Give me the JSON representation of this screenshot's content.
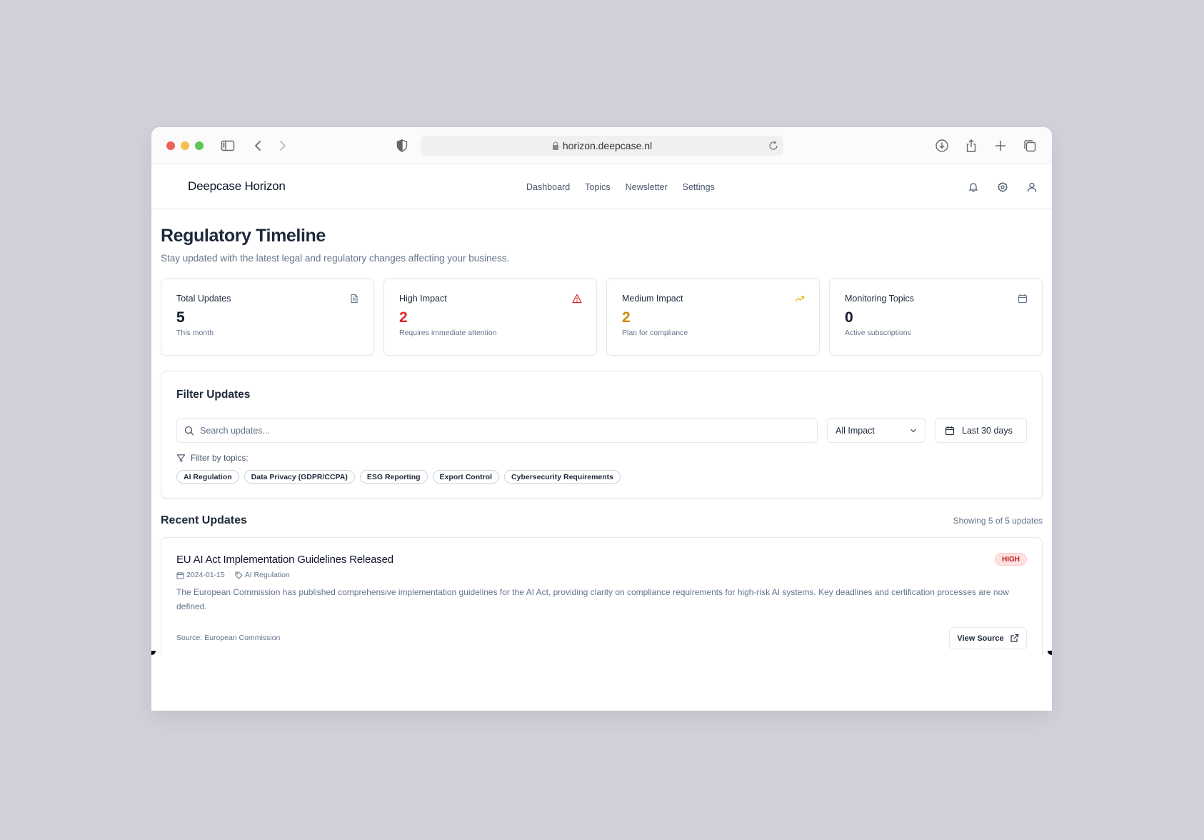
{
  "browser": {
    "url": "horizon.deepcase.nl"
  },
  "app": {
    "brand": "Deepcase Horizon",
    "nav": [
      "Dashboard",
      "Topics",
      "Newsletter",
      "Settings"
    ]
  },
  "page": {
    "title": "Regulatory Timeline",
    "subtitle": "Stay updated with the latest legal and regulatory changes affecting your business."
  },
  "stats": [
    {
      "label": "Total Updates",
      "value": "5",
      "note": "This month",
      "icon": "document-icon",
      "color": "#0f172a"
    },
    {
      "label": "High Impact",
      "value": "2",
      "note": "Requires immediate attention",
      "icon": "alert-triangle-icon",
      "color": "#dc2626"
    },
    {
      "label": "Medium Impact",
      "value": "2",
      "note": "Plan for compliance",
      "icon": "trending-up-icon",
      "color": "#ca8a04"
    },
    {
      "label": "Monitoring Topics",
      "value": "0",
      "note": "Active subscriptions",
      "icon": "calendar-icon",
      "color": "#0f172a"
    }
  ],
  "filter": {
    "title": "Filter Updates",
    "search_placeholder": "Search updates...",
    "impact_select": "All Impact",
    "date_range": "Last 30 days",
    "topics_label": "Filter by topics:",
    "topics": [
      "AI Regulation",
      "Data Privacy (GDPR/CCPA)",
      "ESG Reporting",
      "Export Control",
      "Cybersecurity Requirements"
    ]
  },
  "recent": {
    "title": "Recent Updates",
    "count_text": "Showing 5 of 5 updates",
    "items": [
      {
        "title": "EU AI Act Implementation Guidelines Released",
        "impact": "HIGH",
        "date": "2024-01-15",
        "topic": "AI Regulation",
        "description": "The European Commission has published comprehensive implementation guidelines for the AI Act, providing clarity on compliance requirements for high-risk AI systems. Key deadlines and certification processes are now defined.",
        "source": "Source: European Commission",
        "button": "View Source"
      }
    ]
  }
}
